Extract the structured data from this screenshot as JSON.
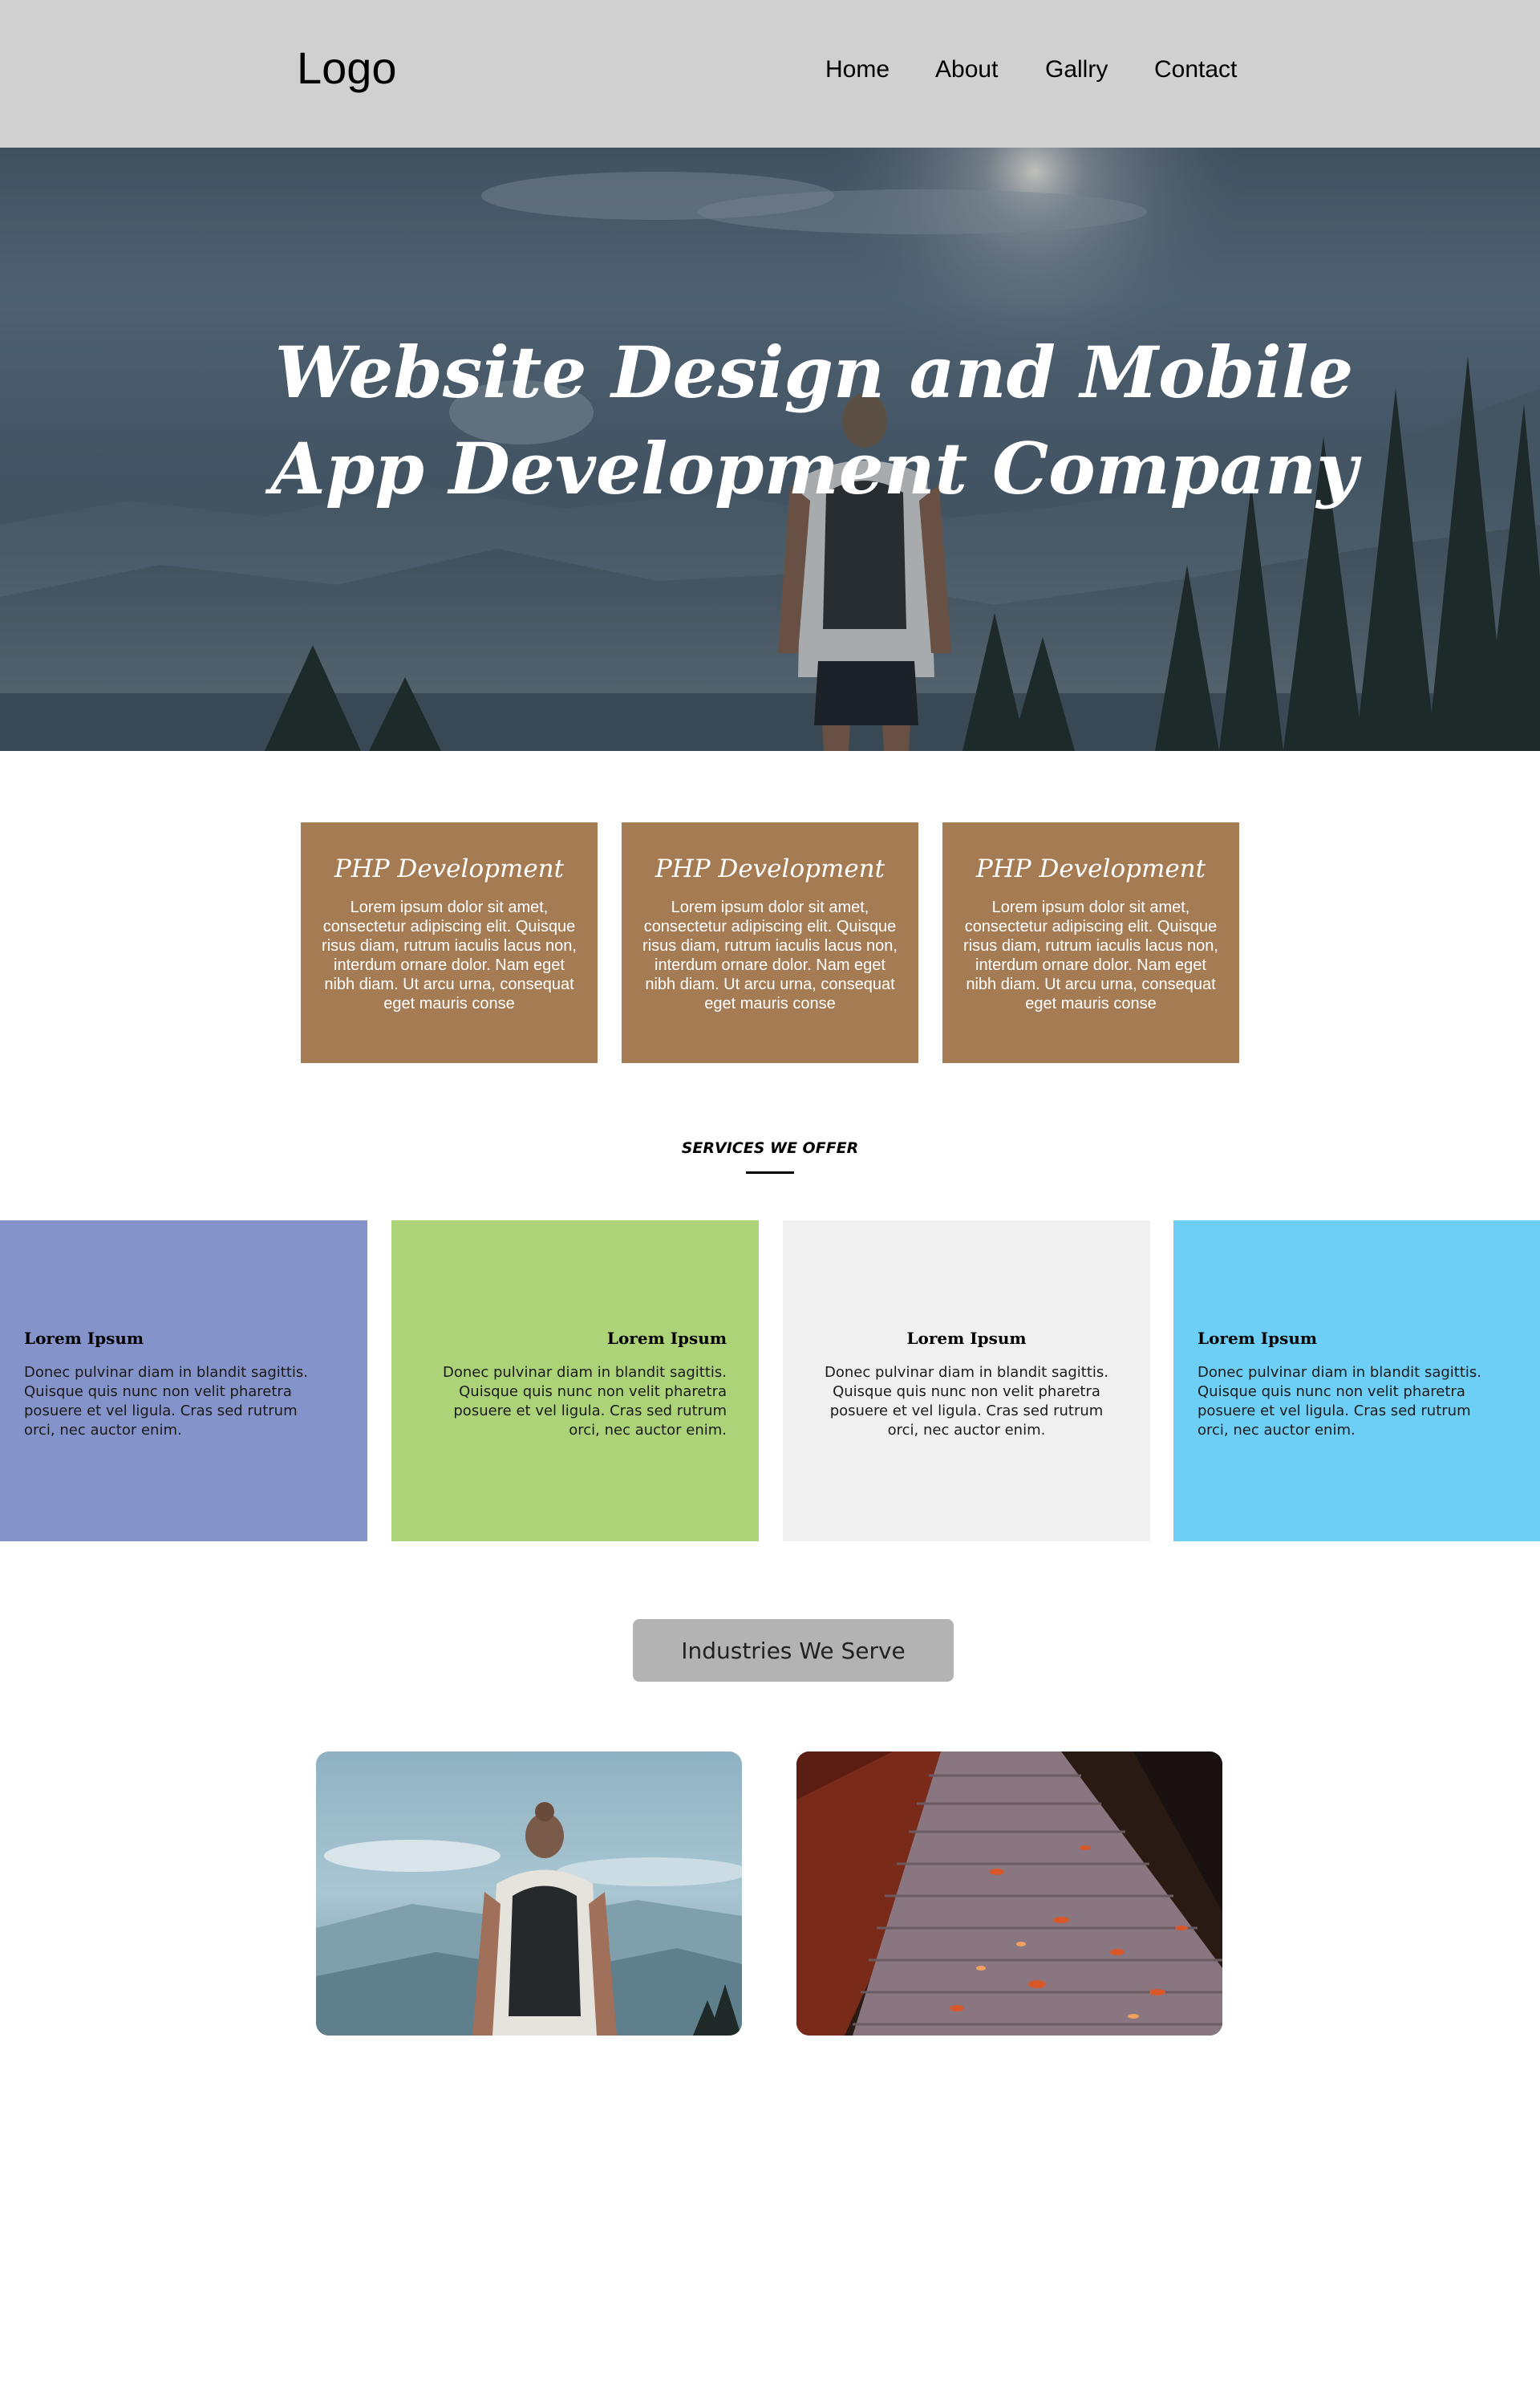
{
  "header": {
    "logo": "Logo",
    "nav": [
      "Home",
      "About",
      "Gallry",
      "Contact"
    ]
  },
  "hero": {
    "title_line1": "Website Design and Mobile",
    "title_line2": "App Development Company"
  },
  "features": [
    {
      "title": "PHP Development",
      "body": "Lorem ipsum dolor sit amet, consectetur adipiscing elit. Quisque risus diam, rutrum iaculis lacus non, interdum ornare dolor. Nam eget nibh diam. Ut arcu urna, consequat eget mauris conse"
    },
    {
      "title": "PHP Development",
      "body": "Lorem ipsum dolor sit amet, consectetur adipiscing elit. Quisque risus diam, rutrum iaculis lacus non, interdum ornare dolor. Nam eget nibh diam. Ut arcu urna, consequat eget mauris conse"
    },
    {
      "title": "PHP Development",
      "body": "Lorem ipsum dolor sit amet, consectetur adipiscing elit. Quisque risus diam, rutrum iaculis lacus non, interdum ornare dolor. Nam eget nibh diam. Ut arcu urna, consequat eget mauris conse"
    }
  ],
  "services": {
    "heading": "SERVICES WE OFFER",
    "items": [
      {
        "title": "Lorem Ipsum",
        "body": "Donec pulvinar diam in blandit sagittis. Quisque quis nunc non velit pharetra posuere et vel ligula. Cras sed rutrum orci, nec auctor enim.",
        "color": "#8493c9"
      },
      {
        "title": "Lorem Ipsum",
        "body": "Donec pulvinar diam in blandit sagittis. Quisque quis nunc non velit pharetra posuere et vel ligula. Cras sed rutrum orci, nec auctor enim.",
        "color": "#acd377"
      },
      {
        "title": "Lorem Ipsum",
        "body": "Donec pulvinar diam in blandit sagittis. Quisque quis nunc non velit pharetra posuere et vel ligula. Cras sed rutrum orci, nec auctor enim.",
        "color": "#f0f0f0"
      },
      {
        "title": "Lorem Ipsum",
        "body": "Donec pulvinar diam in blandit sagittis. Quisque quis nunc non velit pharetra posuere et vel ligula. Cras sed rutrum orci, nec auctor enim.",
        "color": "#6dcff6"
      }
    ]
  },
  "industries": {
    "button_label": "Industries We Serve"
  },
  "colors": {
    "header_bg": "#d0d0d0",
    "card_brown": "#a47b52",
    "button_gray": "#b3b3b3"
  }
}
